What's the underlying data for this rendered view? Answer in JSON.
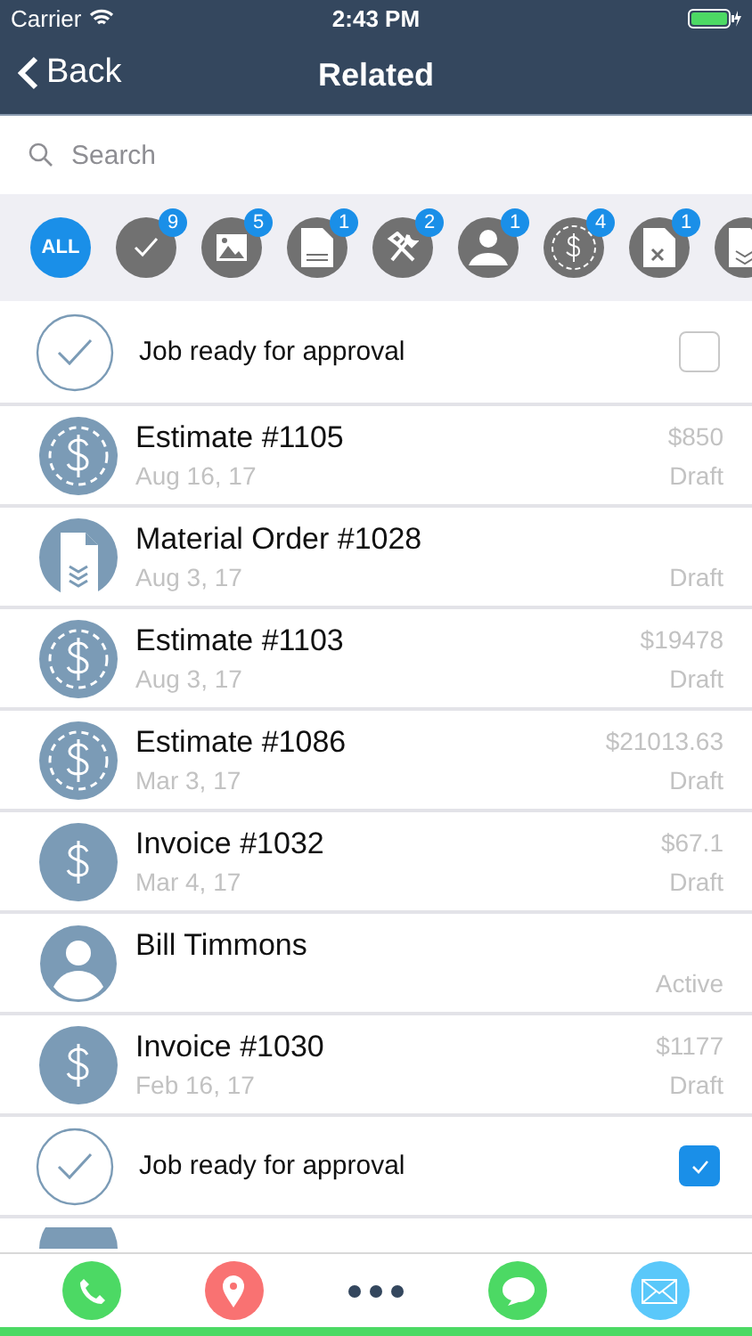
{
  "status_bar": {
    "carrier": "Carrier",
    "time": "2:43 PM"
  },
  "nav": {
    "back": "Back",
    "title": "Related"
  },
  "search": {
    "placeholder": "Search"
  },
  "filters": [
    {
      "kind": "all",
      "label": "ALL",
      "selected": true
    },
    {
      "kind": "check",
      "count": "9",
      "selected": false
    },
    {
      "kind": "image",
      "count": "5",
      "selected": false
    },
    {
      "kind": "document",
      "count": "1",
      "selected": false
    },
    {
      "kind": "tools",
      "count": "2",
      "selected": false
    },
    {
      "kind": "person",
      "count": "1",
      "selected": false
    },
    {
      "kind": "estimate",
      "count": "4",
      "selected": false
    },
    {
      "kind": "work-order",
      "count": "1",
      "selected": false
    },
    {
      "kind": "material",
      "selected": false
    }
  ],
  "rows": [
    {
      "kind": "approval",
      "title": "Job ready for approval",
      "checked": false
    },
    {
      "kind": "estimate",
      "title": "Estimate #1105",
      "date": "Aug 16, 17",
      "amount": "$850",
      "status": "Draft"
    },
    {
      "kind": "material",
      "title": "Material Order #1028",
      "date": "Aug 3, 17",
      "status": "Draft"
    },
    {
      "kind": "estimate",
      "title": "Estimate #1103",
      "date": "Aug 3, 17",
      "amount": "$19478",
      "status": "Draft"
    },
    {
      "kind": "estimate",
      "title": "Estimate #1086",
      "date": "Mar 3, 17",
      "amount": "$21013.63",
      "status": "Draft"
    },
    {
      "kind": "invoice",
      "title": "Invoice #1032",
      "date": "Mar 4, 17",
      "amount": "$67.1",
      "status": "Draft"
    },
    {
      "kind": "contact",
      "title": "Bill Timmons",
      "status": "Active"
    },
    {
      "kind": "invoice",
      "title": "Invoice #1030",
      "date": "Feb 16, 17",
      "amount": "$1177",
      "status": "Draft"
    },
    {
      "kind": "approval",
      "title": "Job ready for approval",
      "checked": true
    },
    {
      "kind": "material-partial"
    }
  ],
  "actions": [
    {
      "kind": "call"
    },
    {
      "kind": "location"
    },
    {
      "kind": "more"
    },
    {
      "kind": "message"
    },
    {
      "kind": "email"
    }
  ]
}
